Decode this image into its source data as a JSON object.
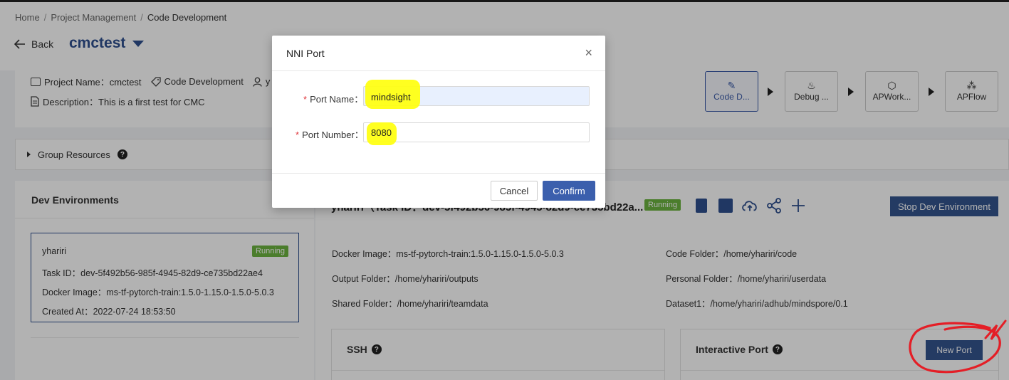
{
  "breadcrumb": {
    "home": "Home",
    "project_management": "Project Management",
    "current": "Code Development",
    "separator": "/"
  },
  "header": {
    "back_label": "Back",
    "project_title": "cmctest"
  },
  "project_info": {
    "project_name_label": "Project Name：cmctest",
    "tag_label": "Code Development",
    "user_label": "y",
    "description_label": "Description：This is a first test for CMC"
  },
  "workflow": {
    "steps": [
      {
        "label": "Code D...",
        "icon": "pencil-icon"
      },
      {
        "label": "Debug ...",
        "icon": "flame-icon"
      },
      {
        "label": "APWork...",
        "icon": "cube-icon"
      },
      {
        "label": "APFlow",
        "icon": "flow-icon"
      }
    ]
  },
  "group_resources": {
    "label": "Group Resources",
    "help": "?"
  },
  "dev_panel": {
    "title": "Dev Environments",
    "env": {
      "name": "yhariri",
      "status": "Running",
      "task_id": "Task ID：dev-5f492b56-985f-4945-82d9-ce735bd22ae4",
      "docker_image": "Docker Image：ms-tf-pytorch-train:1.5.0-1.15.0-1.5.0-5.0.3",
      "created_at": "Created At：2022-07-24 18:53:50"
    }
  },
  "main_panel": {
    "heading": "yhariri（Task ID：dev-5f492b56-985f-4945-82d9-ce735bd22a...",
    "status": "Running",
    "stop_button": "Stop Dev Environment",
    "docker_image": "Docker Image：ms-tf-pytorch-train:1.5.0-1.15.0-1.5.0-5.0.3",
    "output_folder": "Output Folder：/home/yhariri/outputs",
    "shared_folder": "Shared Folder：/home/yhariri/teamdata",
    "code_folder": "Code Folder：/home/yhariri/code",
    "personal_folder": "Personal Folder：/home/yhariri/userdata",
    "dataset1": "Dataset1：/home/yhariri/adhub/mindspore/0.1",
    "ssh_title": "SSH",
    "interactive_port_title": "Interactive Port",
    "new_port_button": "New Port",
    "help": "?"
  },
  "modal": {
    "title": "NNI Port",
    "close": "×",
    "port_name_label": "Port Name：",
    "port_name_value": "mindsight",
    "port_number_label": "Port Number：",
    "port_number_value": "8080",
    "required_mark": "*",
    "cancel_button": "Cancel",
    "confirm_button": "Confirm"
  },
  "colors": {
    "accent": "#34558f",
    "running_badge": "#6cb33f",
    "highlight": "#ffff14",
    "annotation": "#e41e26"
  }
}
